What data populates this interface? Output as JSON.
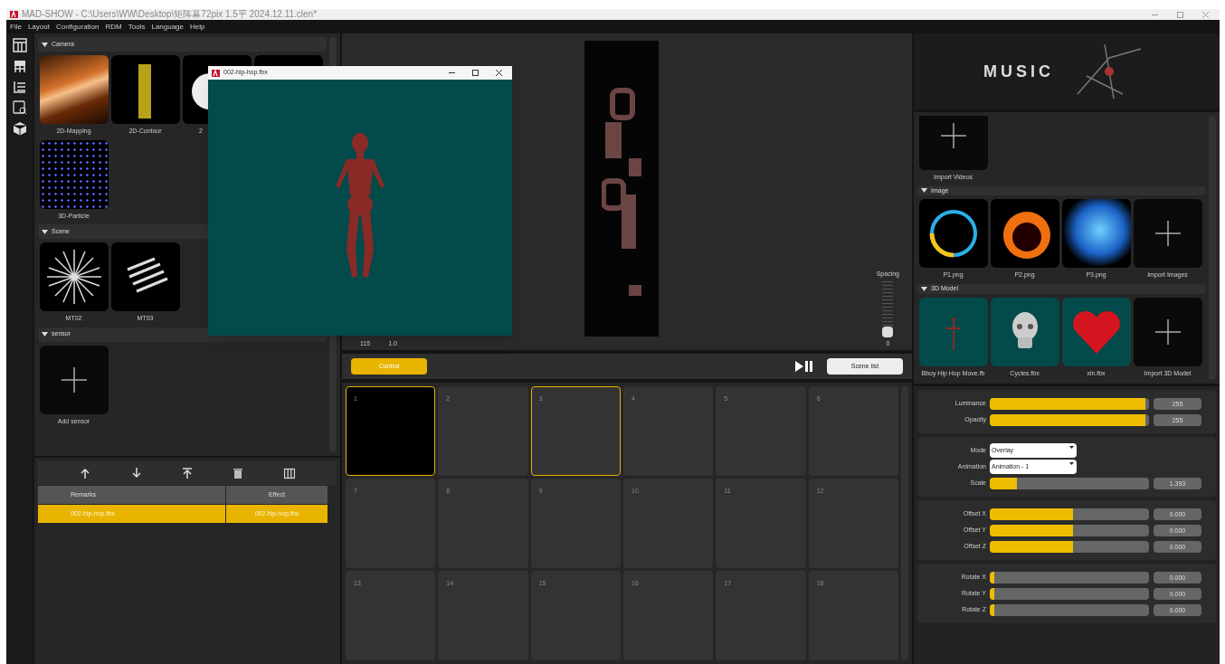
{
  "window": {
    "title": "MAD-SHOW - C:\\Users\\WW\\Desktop\\矩阵幕72pix  1.5平  2024.12.11.clen*"
  },
  "menu": [
    "File",
    "Layout",
    "Configuration",
    "RDM",
    "Tools",
    "Language",
    "Help"
  ],
  "library": {
    "sections": [
      {
        "title": "Camera",
        "items": [
          {
            "label": "2D-Mapping",
            "kind": "streaks"
          },
          {
            "label": "2D-Contour",
            "kind": "dots"
          },
          {
            "label": "2",
            "kind": "partial"
          },
          {
            "kind": "hidden"
          },
          {
            "label": "3D-Particle",
            "kind": "particles"
          }
        ]
      },
      {
        "title": "Scene",
        "items": [
          {
            "label": "MT02",
            "kind": "starburst"
          },
          {
            "label": "MT03",
            "kind": "stripes"
          }
        ]
      },
      {
        "title": "sensor",
        "items": [
          {
            "label": "Add sensor",
            "kind": "add"
          }
        ]
      }
    ]
  },
  "layer_table": {
    "columns": [
      "Remarks",
      "Effect"
    ],
    "rows": [
      {
        "cells": [
          "002-hip-hop.fbx",
          "002-hip-hop.fbx"
        ],
        "selected": true
      }
    ]
  },
  "preview": {
    "readings": [
      "115",
      "1.0"
    ],
    "spacing": {
      "label": "Spacing",
      "level": 0,
      "reading": "0"
    }
  },
  "model_window": {
    "title": "002-hip-hop.fbx"
  },
  "controls": {
    "control_button": "Control",
    "scene_list_button": "Scene list"
  },
  "scenes": [
    {
      "label": "1",
      "selected": true,
      "filled": true
    },
    {
      "label": "2",
      "selected": false,
      "filled": false
    },
    {
      "label": "3",
      "selected": true,
      "filled": false
    },
    {
      "label": "4",
      "selected": false,
      "filled": false
    },
    {
      "label": "5",
      "selected": false,
      "filled": false
    },
    {
      "label": "6",
      "selected": false,
      "filled": false
    },
    {
      "label": "7",
      "selected": false,
      "filled": false
    },
    {
      "label": "8",
      "selected": false,
      "filled": false
    },
    {
      "label": "9",
      "selected": false,
      "filled": false
    },
    {
      "label": "10",
      "selected": false,
      "filled": false
    },
    {
      "label": "11",
      "selected": false,
      "filled": false
    },
    {
      "label": "12",
      "selected": false,
      "filled": false
    },
    {
      "label": "13",
      "selected": false,
      "filled": false
    },
    {
      "label": "14",
      "selected": false,
      "filled": false
    },
    {
      "label": "15",
      "selected": false,
      "filled": false
    },
    {
      "label": "16",
      "selected": false,
      "filled": false
    },
    {
      "label": "17",
      "selected": false,
      "filled": false
    },
    {
      "label": "18",
      "selected": false,
      "filled": false
    }
  ],
  "banner": {
    "logo": "MUSIC"
  },
  "media": {
    "top_items": [
      {
        "label": "Import Videos",
        "kind": "add"
      }
    ],
    "sections": [
      {
        "title": "Image",
        "items": [
          {
            "label": "P1.png",
            "kind": "ring"
          },
          {
            "label": "P2.png",
            "kind": "fireball"
          },
          {
            "label": "P3.png",
            "kind": "sphere"
          },
          {
            "label": "Import Images",
            "kind": "add"
          }
        ]
      },
      {
        "title": "3D Model",
        "items": [
          {
            "label": "Bboy Hip Hop Move.fb",
            "kind": "figure"
          },
          {
            "label": "Cycles.fbx",
            "kind": "skull"
          },
          {
            "label": "xin.fbx",
            "kind": "heart"
          },
          {
            "label": "Import 3D Model",
            "kind": "add"
          }
        ]
      }
    ]
  },
  "properties": [
    {
      "rows": [
        {
          "kind": "slider",
          "label": "Luminance",
          "level": 0.98,
          "reading": "255"
        },
        {
          "kind": "slider",
          "label": "Opacity",
          "level": 0.98,
          "reading": "255"
        }
      ]
    },
    {
      "rows": [
        {
          "kind": "dropdown",
          "label": "Mode",
          "value": "Overlay"
        },
        {
          "kind": "dropdown",
          "label": "Animation",
          "value": "Animation - 1"
        },
        {
          "kind": "slider",
          "label": "Scale",
          "level": 0.17,
          "reading": "1.393"
        }
      ]
    },
    {
      "rows": [
        {
          "kind": "slider",
          "label": "Offset X",
          "level": 0.52,
          "reading": "0.000"
        },
        {
          "kind": "slider",
          "label": "Offset Y",
          "level": 0.52,
          "reading": "0.000"
        },
        {
          "kind": "slider",
          "label": "Offset Z",
          "level": 0.52,
          "reading": "0.000"
        }
      ]
    },
    {
      "rows": [
        {
          "kind": "slider",
          "label": "Rotate X",
          "level": 0.03,
          "reading": "0.000"
        },
        {
          "kind": "slider",
          "label": "Rotate Y",
          "level": 0.03,
          "reading": "0.000"
        },
        {
          "kind": "slider",
          "label": "Rotate Z",
          "level": 0.03,
          "reading": "0.000"
        }
      ]
    }
  ]
}
